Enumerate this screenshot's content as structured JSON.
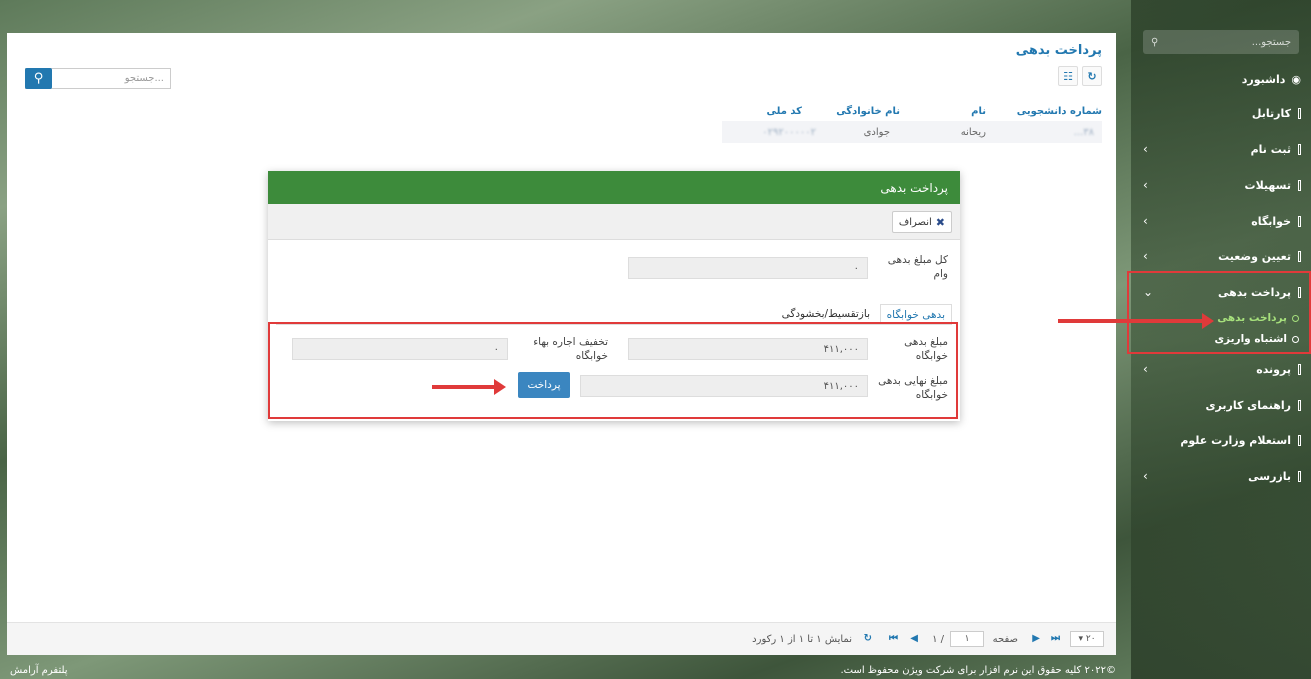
{
  "sidebar": {
    "search_placeholder": "جستجو...",
    "items": [
      {
        "label": "داشبورد",
        "icon": "dashboard-icon",
        "has_children": false
      },
      {
        "label": "کارتابل",
        "icon": "bar-icon",
        "has_children": false
      },
      {
        "label": "ثبت نام",
        "icon": "bar-icon",
        "has_children": true
      },
      {
        "label": "تسهیلات",
        "icon": "bar-icon",
        "has_children": true
      },
      {
        "label": "خوابگاه",
        "icon": "bar-icon",
        "has_children": true
      },
      {
        "label": "تعیین وضعیت",
        "icon": "bar-icon",
        "has_children": true
      },
      {
        "label": "پرداخت بدهی",
        "icon": "bar-icon",
        "has_children": true,
        "expanded": true
      },
      {
        "label": "پرونده",
        "icon": "bar-icon",
        "has_children": true
      },
      {
        "label": "راهنمای کاربری",
        "icon": "bar-icon",
        "has_children": false
      },
      {
        "label": "استعلام وزارت علوم",
        "icon": "bar-icon",
        "has_children": false
      },
      {
        "label": "بازرسی",
        "icon": "bar-icon",
        "has_children": true
      }
    ],
    "subitems": [
      {
        "label": "پرداخت بدهی",
        "active": true
      },
      {
        "label": "اشتباه واریزی",
        "active": false
      }
    ]
  },
  "main": {
    "title": "پرداخت بدهی",
    "search_placeholder": "جستجو...",
    "grid": {
      "columns": [
        "شماره دانشجویی",
        "نام",
        "نام خانوادگی",
        "کد ملی"
      ],
      "rows": [
        [
          "۳۸...",
          "ریحانه",
          "جوادی",
          "۰۲۹۲۰۰۰۰۰۲"
        ]
      ]
    },
    "pager": {
      "page_size": "۲۰",
      "page_label": "صفحه",
      "page_value": "۱",
      "page_total": "/ ۱",
      "summary": "نمایش ۱ تا ۱ از ۱ رکورد"
    }
  },
  "modal": {
    "title": "پرداخت بدهی",
    "cancel_label": "انصراف",
    "total_debt_label": "کل مبلغ بدهی وام",
    "total_debt_value": "۰",
    "tabs": [
      "بدهی خوابگاه",
      "بازتقسیط/بخشودگی"
    ],
    "dorm_debt_label": "مبلغ بدهی خوابگاه",
    "dorm_debt_value": "۴۱۱,۰۰۰",
    "dorm_discount_label": "تخفیف اجاره بهاء خوابگاه",
    "dorm_discount_value": "۰",
    "final_debt_label": "مبلغ نهایی بدهی خوابگاه",
    "final_debt_value": "۴۱۱,۰۰۰",
    "pay_label": "پرداخت"
  },
  "footer": {
    "copyright": "©۲۰۲۲ کلیه حقوق این نرم افزار برای شرکت ویژن محفوظ است.",
    "brand": "پلتفرم آرامش"
  },
  "colors": {
    "accent": "#2278b0",
    "modal_header": "#3d8b3b",
    "highlight": "#e03a3a",
    "active_sub": "#a6e07c"
  }
}
